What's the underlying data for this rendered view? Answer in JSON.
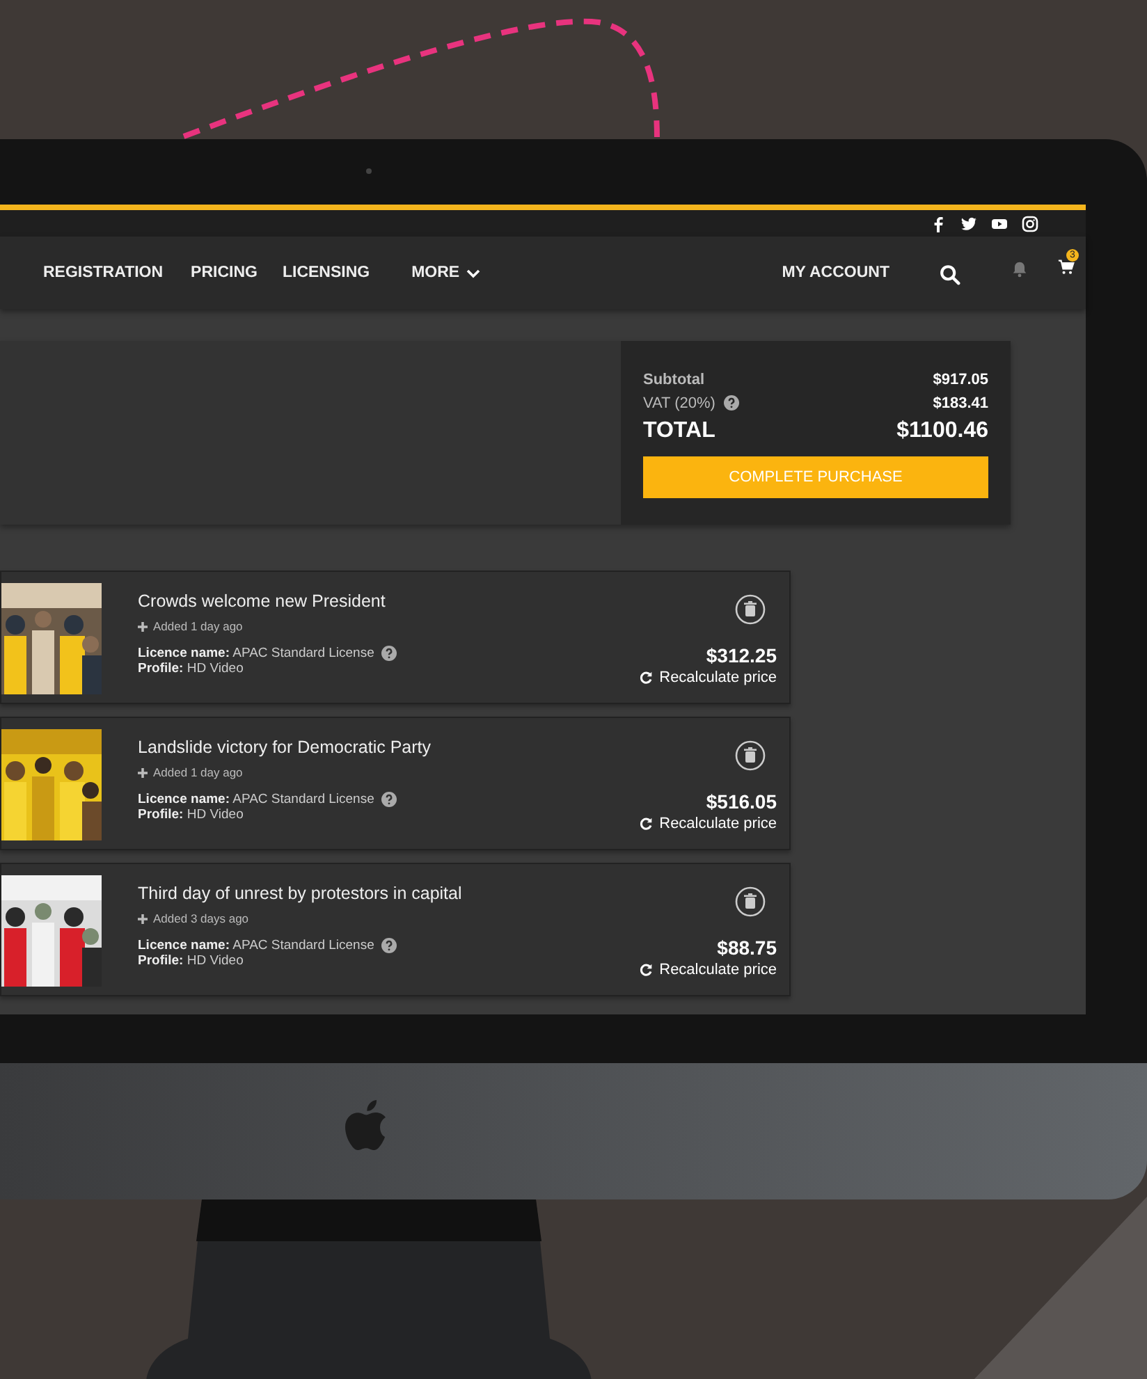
{
  "nav": {
    "items": [
      {
        "label": "REGISTRATION",
        "dropdown": false
      },
      {
        "label": "PRICING",
        "dropdown": false
      },
      {
        "label": "LICENSING",
        "dropdown": false
      },
      {
        "label": "MORE",
        "dropdown": true
      }
    ],
    "account": "MY ACCOUNT",
    "cart_count": "3"
  },
  "summary": {
    "subtotal_label": "Subtotal",
    "subtotal": "$917.05",
    "vat_label": "VAT (20%)",
    "vat": "$183.41",
    "total_label": "TOTAL",
    "total": "$1100.46",
    "button": "COMPLETE PURCHASE"
  },
  "items": [
    {
      "title": "Crowds welcome new President",
      "added": "Added 1 day ago",
      "licence_label": "Licence name:",
      "licence": "APAC Standard License",
      "profile_label": "Profile:",
      "profile": "HD Video",
      "price": "$312.25",
      "recalc": "Recalculate price"
    },
    {
      "title": "Landslide victory for Democratic Party",
      "added": "Added 1 day ago",
      "licence_label": "Licence name:",
      "licence": "APAC Standard License",
      "profile_label": "Profile:",
      "profile": "HD Video",
      "price": "$516.05",
      "recalc": "Recalculate price"
    },
    {
      "title": "Third day of unrest by protestors in capital",
      "added": "Added 3 days ago",
      "licence_label": "Licence name:",
      "licence": "APAC Standard License",
      "profile_label": "Profile:",
      "profile": "HD Video",
      "price": "$88.75",
      "recalc": "Recalculate price"
    }
  ]
}
